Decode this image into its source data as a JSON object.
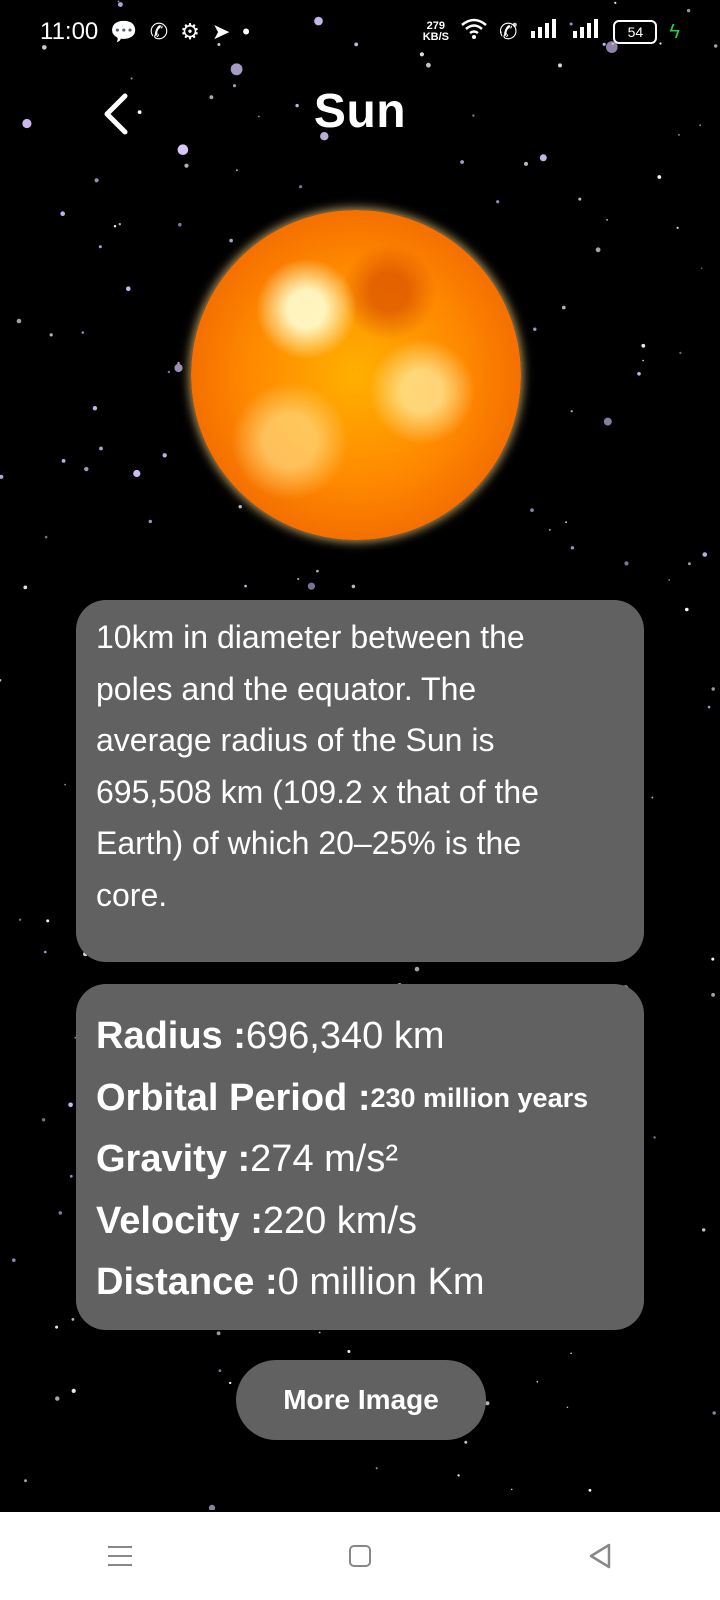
{
  "status_bar": {
    "time": "11:00",
    "net_speed_value": "279",
    "net_speed_unit": "KB/S",
    "battery": "54"
  },
  "header": {
    "back_glyph": "‹",
    "title": "Sun"
  },
  "description": {
    "text": "10km in diameter between the\npoles and the equator. The\naverage radius of the Sun is\n695,508 km (109.2 x that of the\nEarth) of which 20–25% is the\ncore."
  },
  "stats": [
    {
      "key": "Radius : ",
      "value": "696,340 km"
    },
    {
      "key": "Orbital Period : ",
      "value": "230 million years"
    },
    {
      "key": "Gravity : ",
      "value": "274 m/s²"
    },
    {
      "key": "Velocity : ",
      "value": "220 km/s"
    },
    {
      "key": "Distance : ",
      "value": "0 million Km"
    }
  ],
  "more_button": {
    "label": "More Image"
  },
  "icons": {
    "status_left": [
      "chat-bubble-icon",
      "whatsapp-icon",
      "settings-icon",
      "telegram-icon",
      "dot-icon"
    ],
    "status_right": [
      "wifi-icon",
      "wifi-calling-icon",
      "signal-icon",
      "signal-icon",
      "battery-icon",
      "charging-icon"
    ],
    "nav": [
      "menu-icon",
      "home-icon",
      "back-icon"
    ]
  },
  "colors": {
    "background": "#000000",
    "card": "#616161",
    "charging": "#2ecc40"
  }
}
